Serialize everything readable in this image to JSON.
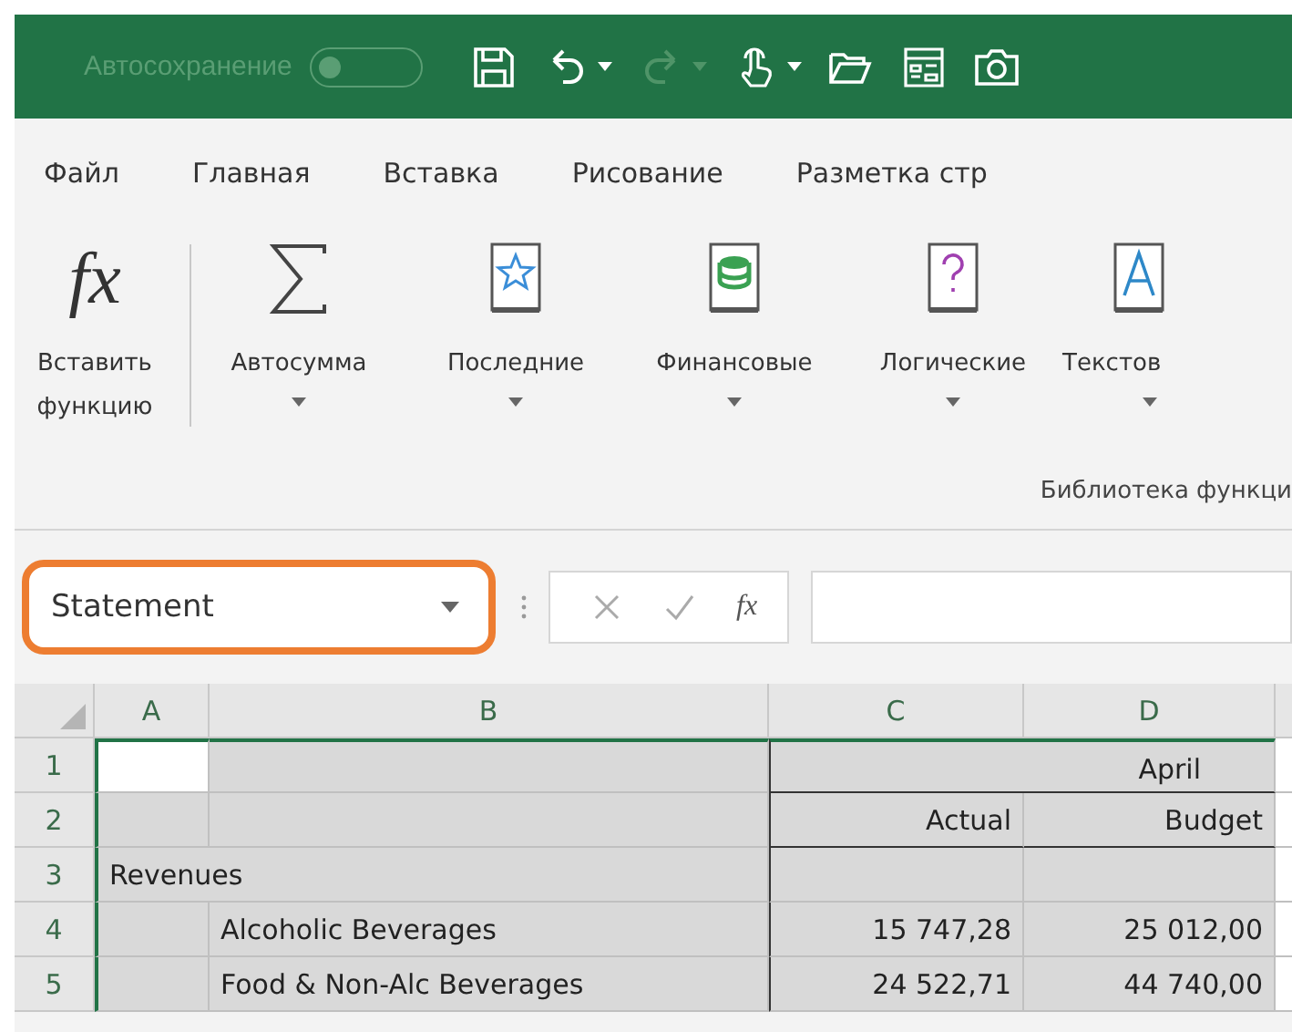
{
  "title_bar": {
    "autosave_label": "Автосохранение",
    "autosave_on": false,
    "quick_access": [
      {
        "kind": "save",
        "menu": false,
        "disabled": false
      },
      {
        "kind": "undo",
        "menu": true,
        "disabled": false
      },
      {
        "kind": "redo",
        "menu": true,
        "disabled": true
      },
      {
        "kind": "touch",
        "menu": true,
        "disabled": false
      },
      {
        "kind": "open",
        "menu": false,
        "disabled": false
      },
      {
        "kind": "form",
        "menu": false,
        "disabled": false
      },
      {
        "kind": "camera",
        "menu": false,
        "disabled": false
      }
    ]
  },
  "tabs": [
    "Файл",
    "Главная",
    "Вставка",
    "Рисование",
    "Разметка стр"
  ],
  "ribbon": {
    "buttons": [
      {
        "kind": "function",
        "glyph": "fx",
        "label": "Вставить функцию",
        "menu": false
      },
      {
        "kind": "sum",
        "label": "Автосумма",
        "menu": true
      },
      {
        "kind": "recent",
        "label": "Последние",
        "menu": true
      },
      {
        "kind": "financial",
        "label": "Финансовые",
        "menu": true
      },
      {
        "kind": "logical",
        "label": "Логические",
        "menu": true
      },
      {
        "kind": "text",
        "label": "Текстов",
        "menu": true
      }
    ],
    "group_label": "Библиотека функци"
  },
  "name_box": {
    "value": "Statement",
    "highlighted": true
  },
  "formula_bar": {
    "buttons": [
      {
        "kind": "cancel"
      },
      {
        "kind": "enter"
      },
      {
        "kind": "function",
        "glyph": "fx"
      }
    ]
  },
  "sheet": {
    "range_selected": true,
    "columns": [
      "A",
      "B",
      "C",
      "D"
    ],
    "rows": [
      {
        "number": "1",
        "month": "April"
      },
      {
        "number": "2",
        "actual": "Actual",
        "budget": "Budget"
      },
      {
        "number": "3",
        "section": "Revenues"
      },
      {
        "number": "4",
        "item": "Alcoholic Beverages",
        "actual": "15 747,28",
        "budget": "25 012,00"
      },
      {
        "number": "5",
        "item": "Food & Non-Alc Beverages",
        "actual": "24 522,71",
        "budget": "44 740,00"
      }
    ]
  }
}
